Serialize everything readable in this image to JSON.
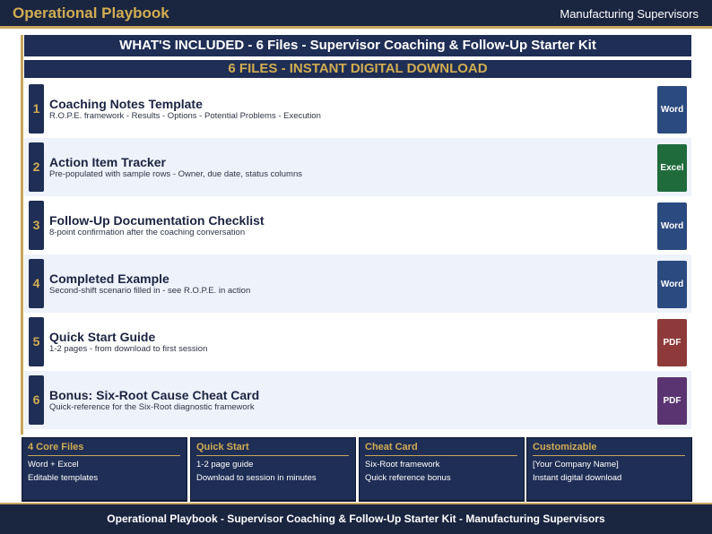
{
  "header": {
    "brand": "Operational Playbook",
    "audience": "Manufacturing Supervisors"
  },
  "banner": {
    "main": "WHAT'S INCLUDED  -  6 Files  -  Supervisor Coaching & Follow-Up Starter Kit",
    "sub": "6 FILES  -  INSTANT DIGITAL DOWNLOAD"
  },
  "files": [
    {
      "num": "1",
      "title": "Coaching Notes Template",
      "desc": "R.O.P.E. framework - Results - Options - Potential Problems - Execution",
      "format": "Word",
      "color": "#2b4a80"
    },
    {
      "num": "2",
      "title": "Action Item Tracker",
      "desc": "Pre-populated with sample rows - Owner, due date, status columns",
      "format": "Excel",
      "color": "#1f6b3c"
    },
    {
      "num": "3",
      "title": "Follow-Up Documentation Checklist",
      "desc": "8-point confirmation after the coaching conversation",
      "format": "Word",
      "color": "#2b4a80"
    },
    {
      "num": "4",
      "title": "Completed Example",
      "desc": "Second-shift scenario filled in - see R.O.P.E. in action",
      "format": "Word",
      "color": "#2b4a80"
    },
    {
      "num": "5",
      "title": "Quick Start Guide",
      "desc": "1-2 pages - from download to first session",
      "format": "PDF",
      "color": "#8e3a3a"
    },
    {
      "num": "6",
      "title": "Bonus: Six-Root Cause Cheat Card",
      "desc": "Quick-reference for the Six-Root diagnostic framework",
      "format": "PDF",
      "color": "#5a3470"
    }
  ],
  "cards": [
    {
      "title": "4 Core Files",
      "line1": "Word + Excel",
      "line2": "Editable templates"
    },
    {
      "title": "Quick Start",
      "line1": "1-2 page guide",
      "line2": "Download to session in minutes"
    },
    {
      "title": "Cheat Card",
      "line1": "Six-Root framework",
      "line2": "Quick reference bonus"
    },
    {
      "title": "Customizable",
      "line1": "[Your Company Name]",
      "line2": "Instant digital download"
    }
  ],
  "footer": {
    "text": "Operational Playbook  -  Supervisor Coaching & Follow-Up Starter Kit  -  Manufacturing Supervisors"
  }
}
